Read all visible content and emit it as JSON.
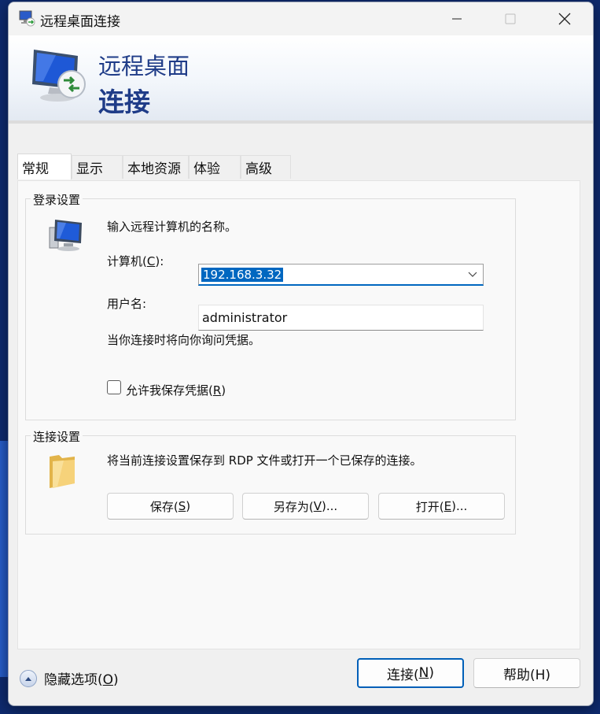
{
  "window": {
    "title": "远程桌面连接",
    "banner_line1": "远程桌面",
    "banner_line2": "连接"
  },
  "tabs": [
    {
      "label": "常规",
      "active": true
    },
    {
      "label": "显示",
      "active": false
    },
    {
      "label": "本地资源",
      "active": false
    },
    {
      "label": "体验",
      "active": false
    },
    {
      "label": "高级",
      "active": false
    }
  ],
  "login_settings": {
    "group_label": "登录设置",
    "prompt": "输入远程计算机的名称。",
    "computer_label_prefix": "计算机(",
    "computer_label_key": "C",
    "computer_label_suffix": "):",
    "computer_value": "192.168.3.32",
    "username_label": "用户名:",
    "username_value": "administrator",
    "credentials_note": "当你连接时将向你询问凭据。",
    "save_credentials_prefix": "允许我保存凭据(",
    "save_credentials_key": "R",
    "save_credentials_suffix": ")",
    "save_credentials_checked": false
  },
  "connection_settings": {
    "group_label": "连接设置",
    "description": "将当前连接设置保存到 RDP 文件或打开一个已保存的连接。",
    "save": {
      "prefix": "保存(",
      "key": "S",
      "suffix": ")"
    },
    "save_as": {
      "prefix": "另存为(",
      "key": "V",
      "suffix": ")..."
    },
    "open": {
      "prefix": "打开(",
      "key": "E",
      "suffix": ")..."
    }
  },
  "footer": {
    "hide_options": {
      "prefix": "隐藏选项(",
      "key": "O",
      "suffix": ")"
    },
    "connect": {
      "prefix": "连接(",
      "key": "N",
      "suffix": ")"
    },
    "help_label": "帮助(H)"
  },
  "colors": {
    "accent": "#0067c0",
    "banner_text": "#1f3c88"
  }
}
